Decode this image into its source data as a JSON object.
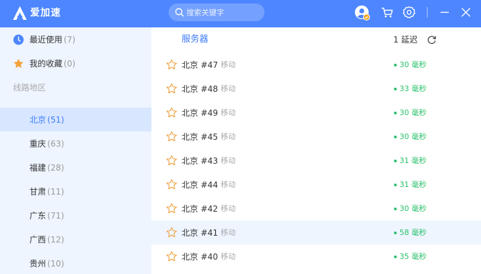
{
  "app": {
    "title": "爱加速",
    "brand_color": "#4d86ff"
  },
  "search": {
    "placeholder": "搜索关键字"
  },
  "titlebar": {
    "icons": [
      "user-avatar-icon",
      "cart-icon",
      "settings-gear-icon",
      "minimize-icon",
      "close-icon"
    ]
  },
  "sidebar": {
    "recent": {
      "label": "最近使用",
      "count": "(7)"
    },
    "favorites": {
      "label": "我的收藏",
      "count": "(0)"
    },
    "section_label": "线路地区",
    "regions": [
      {
        "label": "北京",
        "count": "(51)",
        "active": true
      },
      {
        "label": "重庆",
        "count": "(63)"
      },
      {
        "label": "福建",
        "count": "(28)"
      },
      {
        "label": "甘肃",
        "count": "(11)"
      },
      {
        "label": "广东",
        "count": "(71)"
      },
      {
        "label": "广西",
        "count": "(12)"
      },
      {
        "label": "贵州",
        "count": "(10)"
      }
    ]
  },
  "main": {
    "column_title": "服务器",
    "sort_label": "1 延迟",
    "rows": [
      {
        "name": "北京 #47",
        "isp": "移动",
        "latency": "30 毫秒"
      },
      {
        "name": "北京 #48",
        "isp": "移动",
        "latency": "33 毫秒"
      },
      {
        "name": "北京 #49",
        "isp": "移动",
        "latency": "30 毫秒"
      },
      {
        "name": "北京 #45",
        "isp": "移动",
        "latency": "30 毫秒"
      },
      {
        "name": "北京 #43",
        "isp": "移动",
        "latency": "31 毫秒"
      },
      {
        "name": "北京 #44",
        "isp": "移动",
        "latency": "31 毫秒"
      },
      {
        "name": "北京 #42",
        "isp": "移动",
        "latency": "30 毫秒"
      },
      {
        "name": "北京 #41",
        "isp": "移动",
        "latency": "58 毫秒",
        "highlighted": true
      },
      {
        "name": "北京 #40",
        "isp": "移动",
        "latency": "35 毫秒"
      }
    ]
  },
  "colors": {
    "accent": "#3d7bfa",
    "latency_good": "#29c16a",
    "sidebar_bg": "#eef5ff",
    "active_bg": "#d8e7ff"
  }
}
